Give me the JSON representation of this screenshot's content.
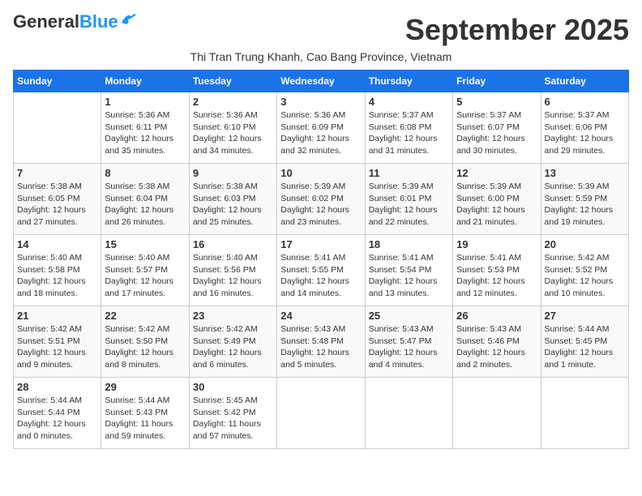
{
  "header": {
    "logo_general": "General",
    "logo_blue": "Blue",
    "month_title": "September 2025",
    "subtitle": "Thi Tran Trung Khanh, Cao Bang Province, Vietnam"
  },
  "weekdays": [
    "Sunday",
    "Monday",
    "Tuesday",
    "Wednesday",
    "Thursday",
    "Friday",
    "Saturday"
  ],
  "weeks": [
    [
      {
        "day": "",
        "sunrise": "",
        "sunset": "",
        "daylight": ""
      },
      {
        "day": "1",
        "sunrise": "Sunrise: 5:36 AM",
        "sunset": "Sunset: 6:11 PM",
        "daylight": "Daylight: 12 hours and 35 minutes."
      },
      {
        "day": "2",
        "sunrise": "Sunrise: 5:36 AM",
        "sunset": "Sunset: 6:10 PM",
        "daylight": "Daylight: 12 hours and 34 minutes."
      },
      {
        "day": "3",
        "sunrise": "Sunrise: 5:36 AM",
        "sunset": "Sunset: 6:09 PM",
        "daylight": "Daylight: 12 hours and 32 minutes."
      },
      {
        "day": "4",
        "sunrise": "Sunrise: 5:37 AM",
        "sunset": "Sunset: 6:08 PM",
        "daylight": "Daylight: 12 hours and 31 minutes."
      },
      {
        "day": "5",
        "sunrise": "Sunrise: 5:37 AM",
        "sunset": "Sunset: 6:07 PM",
        "daylight": "Daylight: 12 hours and 30 minutes."
      },
      {
        "day": "6",
        "sunrise": "Sunrise: 5:37 AM",
        "sunset": "Sunset: 6:06 PM",
        "daylight": "Daylight: 12 hours and 29 minutes."
      }
    ],
    [
      {
        "day": "7",
        "sunrise": "Sunrise: 5:38 AM",
        "sunset": "Sunset: 6:05 PM",
        "daylight": "Daylight: 12 hours and 27 minutes."
      },
      {
        "day": "8",
        "sunrise": "Sunrise: 5:38 AM",
        "sunset": "Sunset: 6:04 PM",
        "daylight": "Daylight: 12 hours and 26 minutes."
      },
      {
        "day": "9",
        "sunrise": "Sunrise: 5:38 AM",
        "sunset": "Sunset: 6:03 PM",
        "daylight": "Daylight: 12 hours and 25 minutes."
      },
      {
        "day": "10",
        "sunrise": "Sunrise: 5:39 AM",
        "sunset": "Sunset: 6:02 PM",
        "daylight": "Daylight: 12 hours and 23 minutes."
      },
      {
        "day": "11",
        "sunrise": "Sunrise: 5:39 AM",
        "sunset": "Sunset: 6:01 PM",
        "daylight": "Daylight: 12 hours and 22 minutes."
      },
      {
        "day": "12",
        "sunrise": "Sunrise: 5:39 AM",
        "sunset": "Sunset: 6:00 PM",
        "daylight": "Daylight: 12 hours and 21 minutes."
      },
      {
        "day": "13",
        "sunrise": "Sunrise: 5:39 AM",
        "sunset": "Sunset: 5:59 PM",
        "daylight": "Daylight: 12 hours and 19 minutes."
      }
    ],
    [
      {
        "day": "14",
        "sunrise": "Sunrise: 5:40 AM",
        "sunset": "Sunset: 5:58 PM",
        "daylight": "Daylight: 12 hours and 18 minutes."
      },
      {
        "day": "15",
        "sunrise": "Sunrise: 5:40 AM",
        "sunset": "Sunset: 5:57 PM",
        "daylight": "Daylight: 12 hours and 17 minutes."
      },
      {
        "day": "16",
        "sunrise": "Sunrise: 5:40 AM",
        "sunset": "Sunset: 5:56 PM",
        "daylight": "Daylight: 12 hours and 16 minutes."
      },
      {
        "day": "17",
        "sunrise": "Sunrise: 5:41 AM",
        "sunset": "Sunset: 5:55 PM",
        "daylight": "Daylight: 12 hours and 14 minutes."
      },
      {
        "day": "18",
        "sunrise": "Sunrise: 5:41 AM",
        "sunset": "Sunset: 5:54 PM",
        "daylight": "Daylight: 12 hours and 13 minutes."
      },
      {
        "day": "19",
        "sunrise": "Sunrise: 5:41 AM",
        "sunset": "Sunset: 5:53 PM",
        "daylight": "Daylight: 12 hours and 12 minutes."
      },
      {
        "day": "20",
        "sunrise": "Sunrise: 5:42 AM",
        "sunset": "Sunset: 5:52 PM",
        "daylight": "Daylight: 12 hours and 10 minutes."
      }
    ],
    [
      {
        "day": "21",
        "sunrise": "Sunrise: 5:42 AM",
        "sunset": "Sunset: 5:51 PM",
        "daylight": "Daylight: 12 hours and 9 minutes."
      },
      {
        "day": "22",
        "sunrise": "Sunrise: 5:42 AM",
        "sunset": "Sunset: 5:50 PM",
        "daylight": "Daylight: 12 hours and 8 minutes."
      },
      {
        "day": "23",
        "sunrise": "Sunrise: 5:42 AM",
        "sunset": "Sunset: 5:49 PM",
        "daylight": "Daylight: 12 hours and 6 minutes."
      },
      {
        "day": "24",
        "sunrise": "Sunrise: 5:43 AM",
        "sunset": "Sunset: 5:48 PM",
        "daylight": "Daylight: 12 hours and 5 minutes."
      },
      {
        "day": "25",
        "sunrise": "Sunrise: 5:43 AM",
        "sunset": "Sunset: 5:47 PM",
        "daylight": "Daylight: 12 hours and 4 minutes."
      },
      {
        "day": "26",
        "sunrise": "Sunrise: 5:43 AM",
        "sunset": "Sunset: 5:46 PM",
        "daylight": "Daylight: 12 hours and 2 minutes."
      },
      {
        "day": "27",
        "sunrise": "Sunrise: 5:44 AM",
        "sunset": "Sunset: 5:45 PM",
        "daylight": "Daylight: 12 hours and 1 minute."
      }
    ],
    [
      {
        "day": "28",
        "sunrise": "Sunrise: 5:44 AM",
        "sunset": "Sunset: 5:44 PM",
        "daylight": "Daylight: 12 hours and 0 minutes."
      },
      {
        "day": "29",
        "sunrise": "Sunrise: 5:44 AM",
        "sunset": "Sunset: 5:43 PM",
        "daylight": "Daylight: 11 hours and 59 minutes."
      },
      {
        "day": "30",
        "sunrise": "Sunrise: 5:45 AM",
        "sunset": "Sunset: 5:42 PM",
        "daylight": "Daylight: 11 hours and 57 minutes."
      },
      {
        "day": "",
        "sunrise": "",
        "sunset": "",
        "daylight": ""
      },
      {
        "day": "",
        "sunrise": "",
        "sunset": "",
        "daylight": ""
      },
      {
        "day": "",
        "sunrise": "",
        "sunset": "",
        "daylight": ""
      },
      {
        "day": "",
        "sunrise": "",
        "sunset": "",
        "daylight": ""
      }
    ]
  ]
}
